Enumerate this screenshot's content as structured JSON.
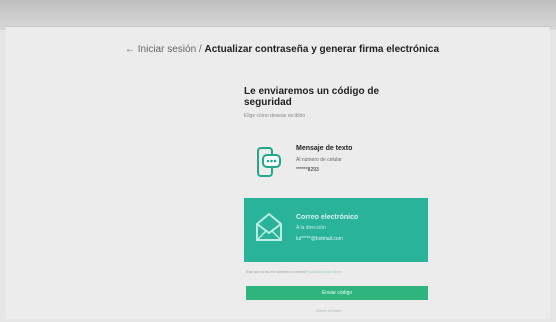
{
  "breadcrumb": {
    "back": "← Iniciar sesión /",
    "current": "Actualizar contraseña y generar firma electrónica"
  },
  "heading": {
    "title": "Le enviaremos un código de seguridad",
    "subtitle": "Elige cómo deseas recibirlo"
  },
  "options": {
    "sms": {
      "title": "Mensaje de texto",
      "description": "Al número de celular",
      "value": "******8293",
      "icon": "phone-chat-icon"
    },
    "email": {
      "title": "Correo electrónico",
      "description": "A la dirección",
      "value": "lui*****@hotmail.com",
      "icon": "envelope-icon"
    }
  },
  "footer": {
    "note_text": "Ese ya no es mi número o correo?",
    "note_link": "Actualiza tus datos"
  },
  "actions": {
    "send_label": "Enviar código",
    "secondary_link": "Volver al inicio"
  },
  "colors": {
    "accent": "#28b39a",
    "button": "#2fb47e"
  }
}
